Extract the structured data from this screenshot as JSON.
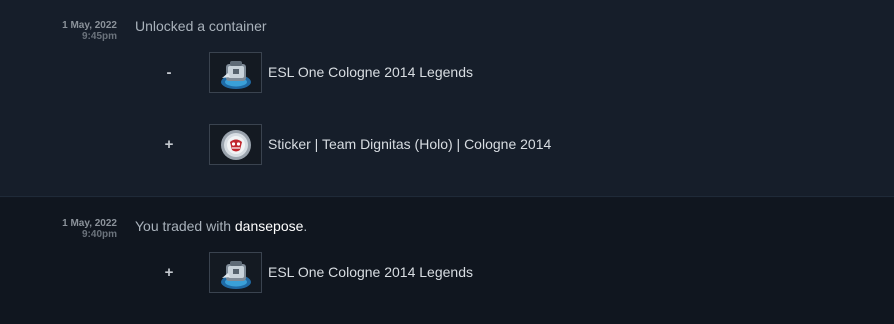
{
  "history": [
    {
      "date": "1 May, 2022",
      "time": "9:45pm",
      "description": "Unlocked a container",
      "items": [
        {
          "sign": "-",
          "name": "ESL One Cologne 2014 Legends",
          "icon": "case-icon"
        },
        {
          "sign": "+",
          "name": "Sticker | Team Dignitas (Holo) | Cologne 2014",
          "icon": "sticker-icon"
        }
      ]
    },
    {
      "date": "1 May, 2022",
      "time": "9:40pm",
      "description_prefix": "You traded with ",
      "partner": "dansepose",
      "description_suffix": ".",
      "items": [
        {
          "sign": "+",
          "name": "ESL One Cologne 2014 Legends",
          "icon": "case-icon"
        }
      ]
    }
  ],
  "colors": {
    "row_primary_bg": "#161e2a",
    "row_secondary_bg": "#10161f",
    "partner_text": "#ffffff",
    "item_text": "#d8dde2",
    "date_text": "#8b929a"
  }
}
